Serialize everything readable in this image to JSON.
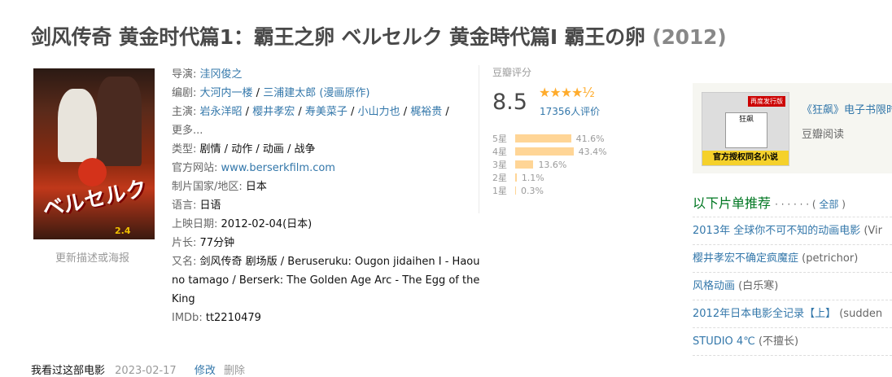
{
  "title": {
    "main": "剑风传奇 黄金时代篇1：霸王之卵 ベルセルク 黄金時代篇Ⅰ 霸王の卵",
    "year": "(2012)"
  },
  "poster": {
    "title_art": "ベルセルク",
    "date": "2.4",
    "update_link": "更新描述或海报"
  },
  "info": {
    "director_label": "导演:",
    "director": "洼冈俊之",
    "writer_label": "编剧:",
    "writers": [
      "大河内一楼",
      "三浦建太郎 (漫画原作)"
    ],
    "cast_label": "主演:",
    "cast": [
      "岩永洋昭",
      "樱井孝宏",
      "寿美菜子",
      "小山力也",
      "梶裕贵"
    ],
    "more": "更多...",
    "genre_label": "类型:",
    "genres": [
      "剧情",
      "动作",
      "动画",
      "战争"
    ],
    "site_label": "官方网站:",
    "site": "www.berserkfilm.com",
    "country_label": "制片国家/地区:",
    "country": "日本",
    "language_label": "语言:",
    "language": "日语",
    "release_label": "上映日期:",
    "release": "2012-02-04(日本)",
    "runtime_label": "片长:",
    "runtime": "77分钟",
    "aka_label": "又名:",
    "aka": "剑风传奇 剧场版 / Beruseruku: Ougon jidaihen I - Haou no tamago / Berserk: The Golden Age Arc - The Egg of the King",
    "imdb_label": "IMDb:",
    "imdb": "tt2210479"
  },
  "rating": {
    "label": "豆瓣评分",
    "score": "8.5",
    "stars": "★★★★½",
    "count": "17356人评价",
    "dist": [
      {
        "label": "5星",
        "pct": "41.6%",
        "value": 41.6
      },
      {
        "label": "4星",
        "pct": "43.4%",
        "value": 43.4
      },
      {
        "label": "3星",
        "pct": "13.6%",
        "value": 13.6
      },
      {
        "label": "2星",
        "pct": "1.1%",
        "value": 1.1
      },
      {
        "label": "1星",
        "pct": "0.3%",
        "value": 0.3
      }
    ]
  },
  "ad": {
    "title": "《狂飙》电子书限时",
    "source": "豆瓣阅读",
    "cover_book": "狂飙",
    "cover_tag": "再度发行版",
    "cover_banner": "官方授权同名小说"
  },
  "recs": {
    "heading": "以下片单推荐",
    "dots": "· · · · · ·",
    "all": "全部",
    "items": [
      {
        "name": "2013年 全球你不可不知的动画电影",
        "owner": "(Vir"
      },
      {
        "name": "樱井孝宏不确定疯魔症",
        "owner": "(petrichor)"
      },
      {
        "name": "风格动画",
        "owner": "(白乐寒)"
      },
      {
        "name": "2012年日本电影全记录【上】",
        "owner": "(sudden"
      },
      {
        "name": "STUDIO 4℃",
        "owner": "(不擅长)"
      }
    ]
  },
  "bottom": {
    "seen": "我看过这部电影",
    "date": "2023-02-17",
    "edit": "修改",
    "delete": "删除"
  }
}
